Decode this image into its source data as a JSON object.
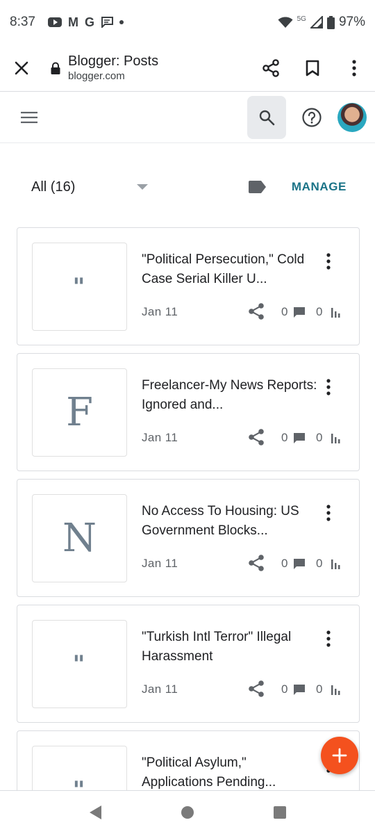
{
  "status_bar": {
    "time": "8:37",
    "notification_icons": [
      "youtube-icon",
      "gmail-icon",
      "google-icon",
      "message-icon",
      "dot-icon"
    ],
    "gmail_glyph": "M",
    "google_glyph": "G",
    "network": "5G",
    "battery": "97%"
  },
  "custom_tab": {
    "title": "Blogger: Posts",
    "url": "blogger.com"
  },
  "filter": {
    "selected": "All (16)",
    "manage_label": "MANAGE"
  },
  "posts": [
    {
      "thumb_type": "quote",
      "thumb": "\"",
      "title": "\"Political Persecution,\" Cold Case Serial Killer U...",
      "date": "Jan 11",
      "comments": "0",
      "views": "0"
    },
    {
      "thumb_type": "letter",
      "thumb": "F",
      "title": "Freelancer-My News Reports: Ignored and...",
      "date": "Jan 11",
      "comments": "0",
      "views": "0"
    },
    {
      "thumb_type": "letter",
      "thumb": "N",
      "title": "No Access To Housing: US Government Blocks...",
      "date": "Jan 11",
      "comments": "0",
      "views": "0"
    },
    {
      "thumb_type": "quote",
      "thumb": "\"",
      "title": "\"Turkish Intl Terror\" Illegal Harassment",
      "date": "Jan 11",
      "comments": "0",
      "views": "0"
    },
    {
      "thumb_type": "quote",
      "thumb": "\"",
      "title": "\"Political Asylum,\" Applications Pending...",
      "date": "",
      "comments": "",
      "views": ""
    }
  ],
  "colors": {
    "accent": "#1a7387",
    "fab": "#f4511e",
    "icon": "#5f6368",
    "thumb_text": "#70808e"
  }
}
